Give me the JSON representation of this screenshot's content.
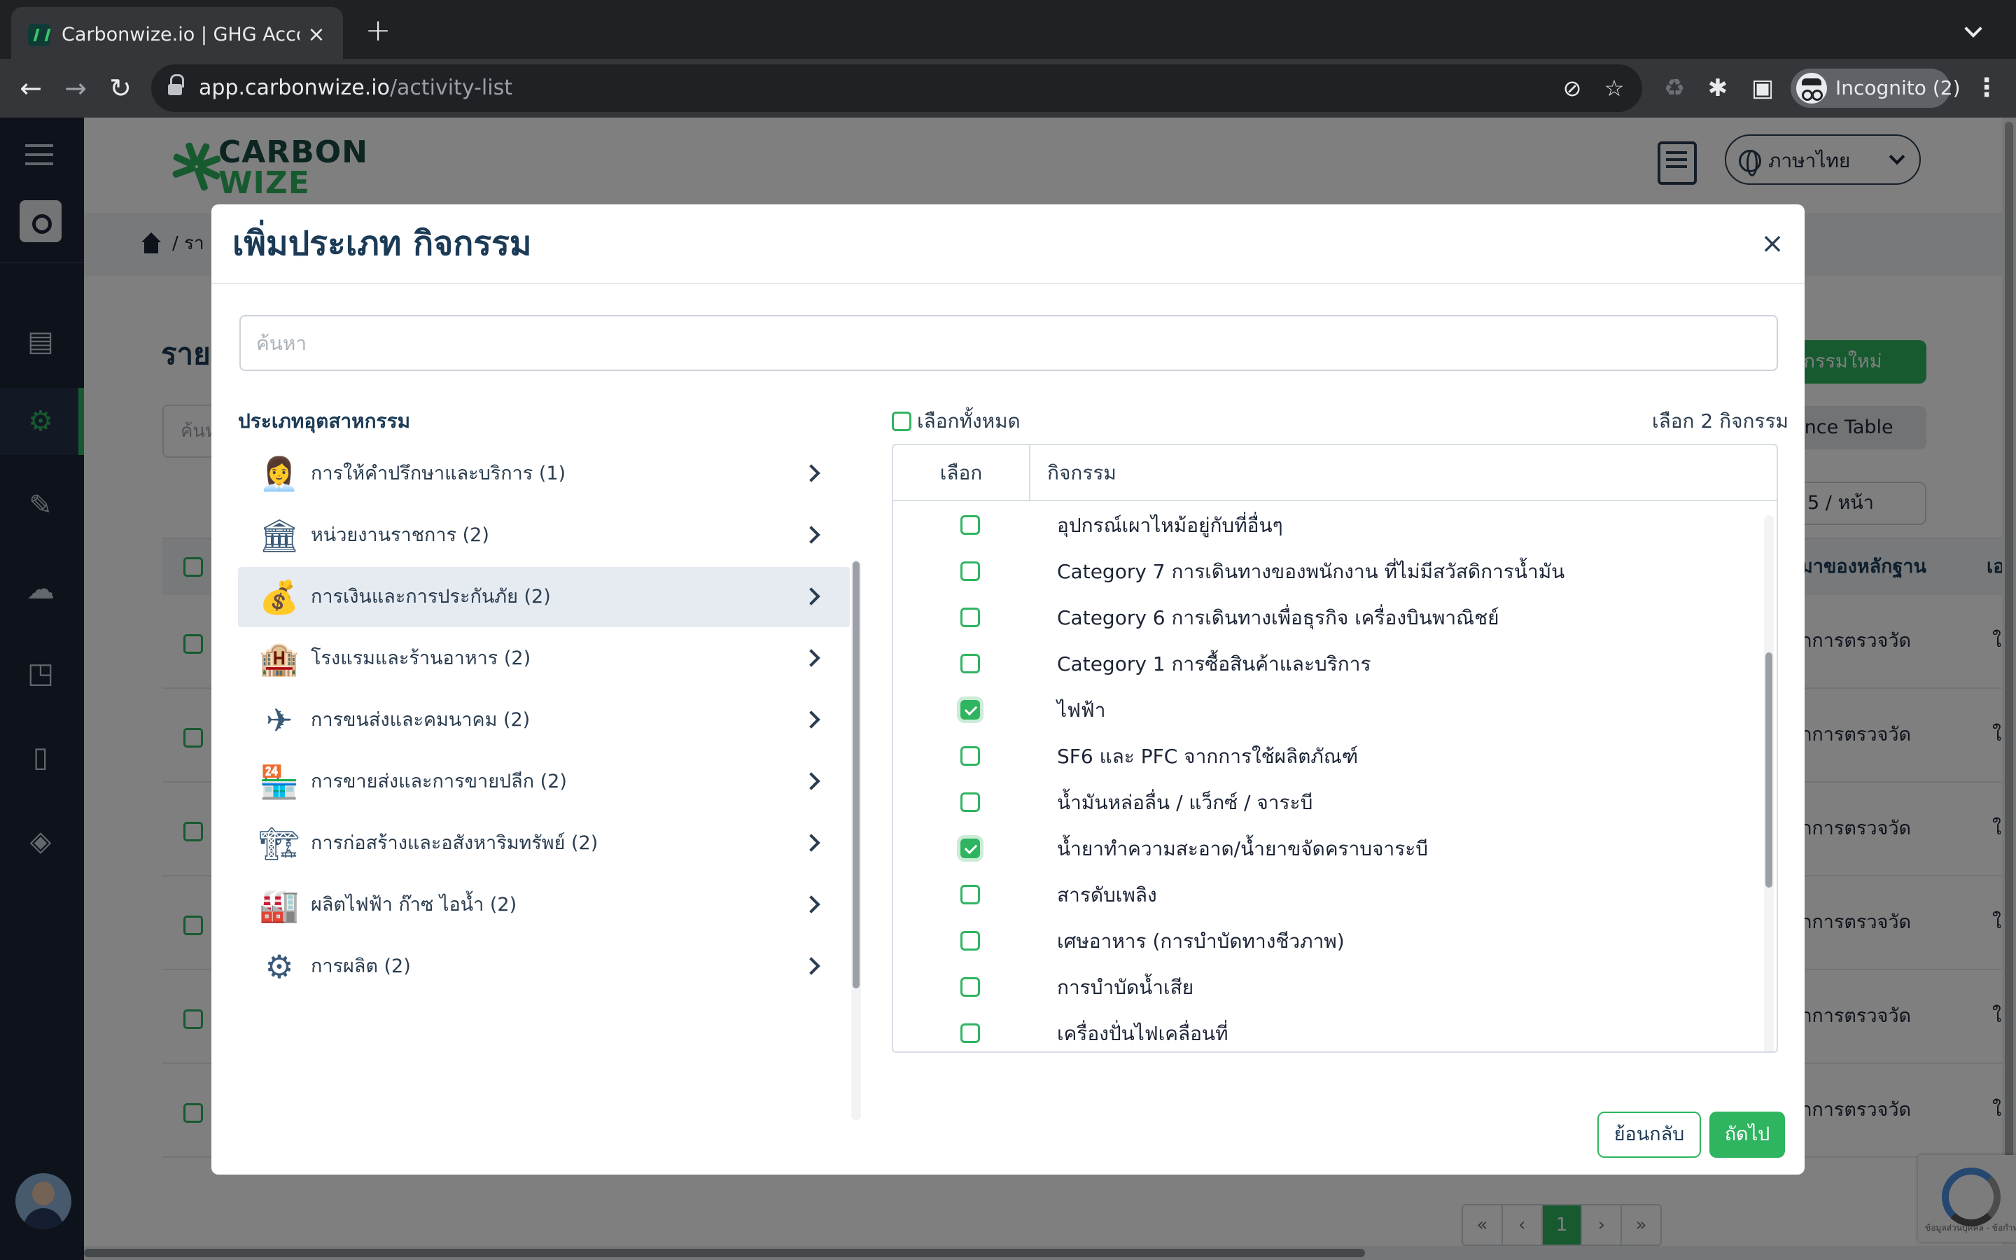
{
  "browser": {
    "tab_title": "Carbonwize.io | GHG Accounti",
    "tab_close": "×",
    "new_tab": "+",
    "url_host": "app.carbonwize.io",
    "url_path": "/activity-list",
    "back": "←",
    "forward": "→",
    "reload": "↻",
    "incognito_label": "Incognito (2)",
    "menu": "⋮",
    "icons": [
      "eye-off-icon",
      "star-icon",
      "recycle-icon",
      "puzzle-icon",
      "sidepanel-icon",
      "incognito-icon"
    ]
  },
  "app": {
    "logo_line1": "CARBON",
    "logo_line2": "WIZE",
    "language": "ภาษาไทย",
    "breadcrumb_partial": "/ รา",
    "page_title_partial": "ราย",
    "search_placeholder_partial": "ค้นห",
    "new_activity_partial": "รกิจกรรมใหม่",
    "advance_table_partial": "dvance Table",
    "per_page_partial": "5 / หน้า",
    "col_evidence_partial": "มาของหลักฐาน",
    "col_extra_partial": "เอ",
    "row_value_partial": "กการตรวจวัด",
    "row_value_extra_partial": "ใบ",
    "row_count": 6,
    "pager": [
      "«",
      "‹",
      "1",
      "›",
      "»"
    ],
    "recaptcha_text": "ข้อมูลส่วนบุคคล - ข้อกำหนด",
    "accent_color": "#2fb460",
    "sidebar_color": "#1c2536"
  },
  "modal": {
    "title": "เพิ่มประเภท กิจกรรม",
    "close": "×",
    "search_placeholder": "ค้นหา",
    "search_value": "",
    "industry_heading": "ประเภทอุตสาหกรรม",
    "industries": [
      {
        "label": "การให้คำปรึกษาและบริการ (1)",
        "icon": "consultant-icon",
        "active": false
      },
      {
        "label": "หน่วยงานราชการ (2)",
        "icon": "government-icon",
        "active": false
      },
      {
        "label": "การเงินและการประกันภัย (2)",
        "icon": "finance-icon",
        "active": true
      },
      {
        "label": "โรงแรมและร้านอาหาร (2)",
        "icon": "hotel-icon",
        "active": false
      },
      {
        "label": "การขนส่งและคมนาคม (2)",
        "icon": "transport-icon",
        "active": false
      },
      {
        "label": "การขายส่งและการขายปลีก (2)",
        "icon": "retail-icon",
        "active": false
      },
      {
        "label": "การก่อสร้างและอสังหาริมทรัพย์ (2)",
        "icon": "construction-icon",
        "active": false
      },
      {
        "label": "ผลิตไฟฟ้า ก๊าซ ไอน้ำ (2)",
        "icon": "power-plant-icon",
        "active": false
      },
      {
        "label": "การผลิต (2)",
        "icon": "manufacturing-icon",
        "active": false
      }
    ],
    "select_all_label": "เลือกทั้งหมด",
    "selected_count": "เลือก 2 กิจกรรม",
    "col_select": "เลือก",
    "col_activity": "กิจกรรม",
    "activities": [
      {
        "name": "อุปกรณ์เผาไหม้อยู่กับที่อื่นๆ",
        "checked": false
      },
      {
        "name": "Category 7 การเดินทางของพนักงาน ที่ไม่มีสวัสดิการน้ำมัน",
        "checked": false
      },
      {
        "name": "Category 6 การเดินทางเพื่อธุรกิจ เครื่องบินพาณิชย์",
        "checked": false
      },
      {
        "name": "Category 1 การซื้อสินค้าและบริการ",
        "checked": false
      },
      {
        "name": "ไฟฟ้า",
        "checked": true
      },
      {
        "name": "SF6 และ PFC จากการใช้ผลิตภัณฑ์",
        "checked": false
      },
      {
        "name": "น้ำมันหล่อลื่น / แว็กซ์ / จาระบี",
        "checked": false
      },
      {
        "name": "น้ำยาทำความสะอาด/น้ำยาขจัดคราบจาระบี",
        "checked": true
      },
      {
        "name": "สารดับเพลิง",
        "checked": false
      },
      {
        "name": "เศษอาหาร (การบำบัดทางชีวภาพ)",
        "checked": false
      },
      {
        "name": "การบำบัดน้ำเสีย",
        "checked": false
      },
      {
        "name": "เครื่องปั่นไฟเคลื่อนที่",
        "checked": false
      }
    ],
    "back_label": "ย้อนกลับ",
    "next_label": "ถัดไป"
  }
}
